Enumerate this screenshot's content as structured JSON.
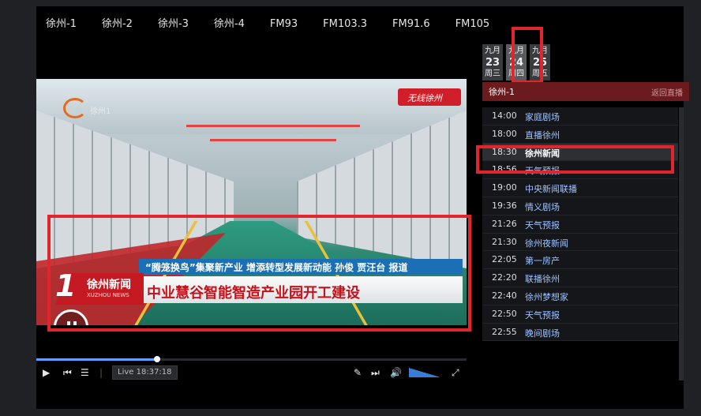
{
  "channels": [
    "徐州-1",
    "徐州-2",
    "徐州-3",
    "徐州-4",
    "FM93",
    "FM103.3",
    "FM91.6",
    "FM105"
  ],
  "video": {
    "tl_logo_text": "徐州1",
    "tr_logo_text": "无线徐州",
    "subtitle": "“腾笼换鸟”集聚新产业  增添转型发展新动能   孙俊  贾汪台  报道",
    "headline": "中业慧谷智能智造产业园开工建设",
    "badge_number": "1",
    "badge_title": "徐州新闻",
    "badge_sub": "XUZHOU NEWS",
    "badge_ch": "新闻"
  },
  "player": {
    "live_label": "Live",
    "time": "18:37:18",
    "progress_fraction": 0.28
  },
  "dates": [
    {
      "month": "九月",
      "day": "23",
      "weekday": "周三"
    },
    {
      "month": "九月",
      "day": "24",
      "weekday": "周四"
    },
    {
      "month": "九月",
      "day": "25",
      "weekday": "周五"
    }
  ],
  "channel_header": {
    "name": "徐州-1",
    "back": "返回直播"
  },
  "schedule": [
    {
      "time": "14:00",
      "name": "家庭剧场"
    },
    {
      "time": "18:00",
      "name": "直播徐州"
    },
    {
      "time": "18:30",
      "name": "徐州新闻"
    },
    {
      "time": "18:56",
      "name": "天气预报"
    },
    {
      "time": "19:00",
      "name": "中央新闻联播"
    },
    {
      "time": "19:36",
      "name": "情义剧场"
    },
    {
      "time": "21:26",
      "name": "天气预报"
    },
    {
      "time": "21:30",
      "name": "徐州夜新闻"
    },
    {
      "time": "22:05",
      "name": "第一房产"
    },
    {
      "time": "22:20",
      "name": "联播徐州"
    },
    {
      "time": "22:40",
      "name": "徐州梦想家"
    },
    {
      "time": "22:50",
      "name": "天气预报"
    },
    {
      "time": "22:55",
      "name": "晚间剧场"
    }
  ],
  "colors": {
    "accent": "#e0262c",
    "header_red": "#6b1b1d",
    "link_blue": "#9fc3ff",
    "progress": "#5e9fff"
  },
  "icons": {
    "play": "play-icon",
    "prev": "prev-icon",
    "list": "playlist-icon",
    "edit": "edit-icon",
    "skip": "skip-icon",
    "volume": "volume-icon",
    "fullscreen": "fullscreen-icon"
  }
}
